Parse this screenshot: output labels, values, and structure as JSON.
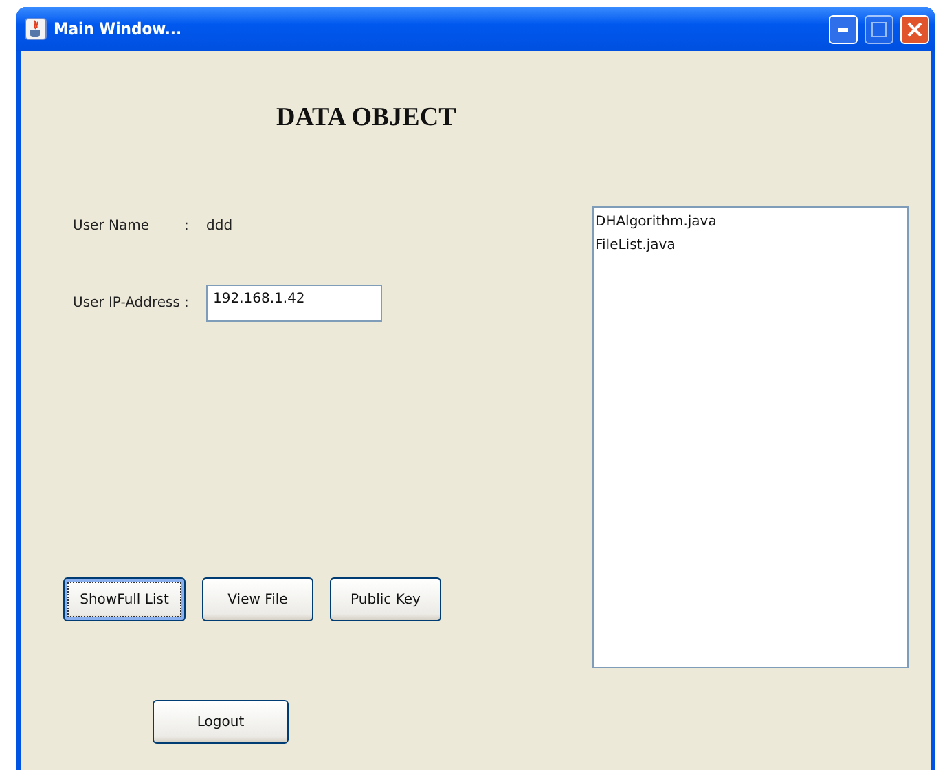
{
  "window": {
    "title": "Main Window..."
  },
  "heading": "DATA OBJECT",
  "fields": [
    {
      "label": "User Name",
      "separator": ":",
      "kind": "text",
      "value": "ddd"
    },
    {
      "label": "User IP-Address",
      "separator": ":",
      "kind": "input",
      "value": "192.168.1.42"
    }
  ],
  "buttons": [
    {
      "label": "ShowFull List",
      "focused": true
    },
    {
      "label": "View File",
      "focused": false
    },
    {
      "label": "Public Key",
      "focused": false
    }
  ],
  "logout": {
    "label": "Logout",
    "focused": false
  },
  "file_list": {
    "items": [
      "DHAlgorithm.java",
      "FileList.java"
    ]
  }
}
